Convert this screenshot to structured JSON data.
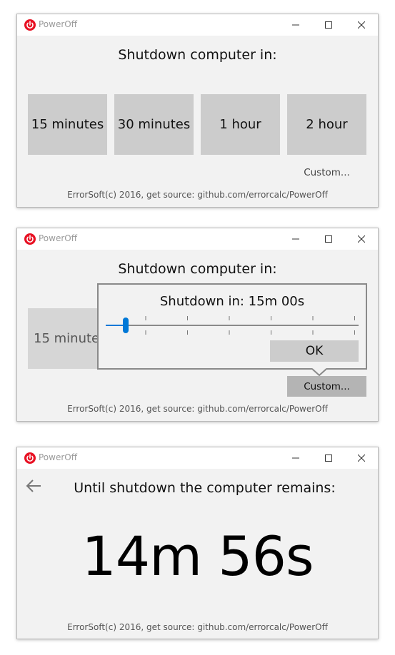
{
  "app": {
    "title": "PowerOff"
  },
  "window1": {
    "heading": "Shutdown computer in:",
    "presets": [
      "15 minutes",
      "30 minutes",
      "1 hour",
      "2 hour"
    ],
    "custom_label": "Custom...",
    "footer": "ErrorSoft(c) 2016, get source: github.com/errorcalc/PowerOff"
  },
  "window2": {
    "heading": "Shutdown computer in:",
    "preset_partial": "15 minute",
    "popup": {
      "label": "Shutdown in: 15m 00s",
      "slider_value_fraction": 0.08,
      "ok_label": "OK"
    },
    "custom_label": "Custom...",
    "footer": "ErrorSoft(c) 2016, get source: github.com/errorcalc/PowerOff"
  },
  "window3": {
    "heading": "Until shutdown the computer remains:",
    "countdown": "14m 56s",
    "footer": "ErrorSoft(c) 2016, get source: github.com/errorcalc/PowerOff"
  },
  "colors": {
    "accent": "#0078d7",
    "app_icon": "#e81123",
    "tile": "#cccccc"
  },
  "icons": [
    "power-icon",
    "minimize-icon",
    "maximize-icon",
    "close-icon",
    "back-arrow-icon"
  ]
}
